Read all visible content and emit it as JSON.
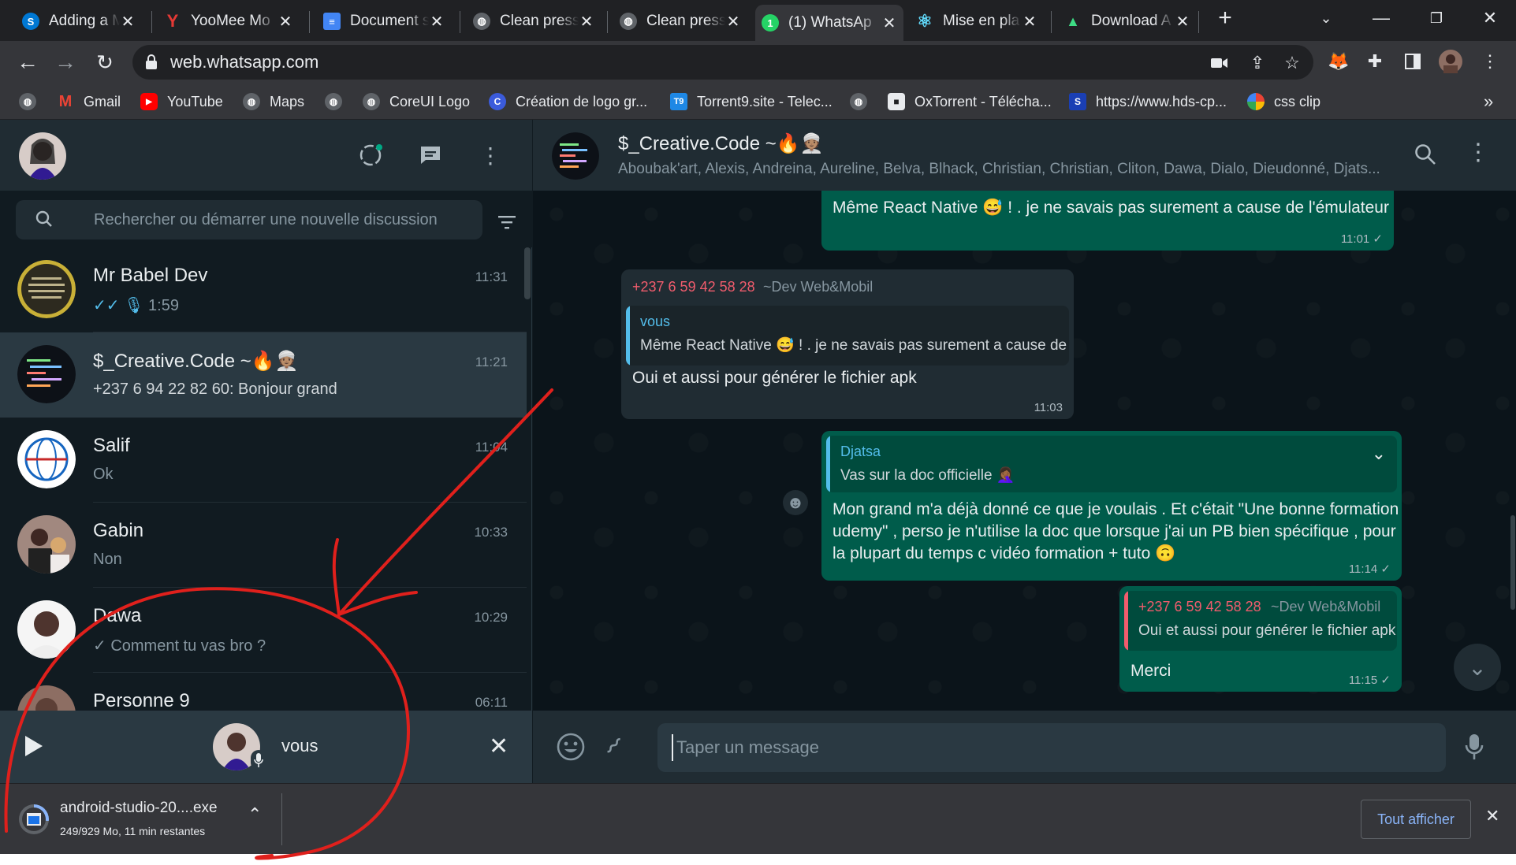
{
  "browser": {
    "tabs": [
      {
        "title": "Adding a M",
        "icon": "skype-icon",
        "color": "#0078d4",
        "glyph": "S"
      },
      {
        "title": "YooMee Mo",
        "icon": "yoomee-icon",
        "color": "#e53935",
        "glyph": "Y"
      },
      {
        "title": "Document s",
        "icon": "docs-icon",
        "color": "#4285f4",
        "glyph": "≡"
      },
      {
        "title": "Clean press",
        "icon": "globe-icon",
        "color": "#5f6368",
        "glyph": "◍"
      },
      {
        "title": "Clean press",
        "icon": "globe-icon",
        "color": "#5f6368",
        "glyph": "◍"
      },
      {
        "title": "(1) WhatsAp",
        "icon": "whatsapp-icon",
        "color": "#25d366",
        "glyph": "1"
      },
      {
        "title": "Mise en pla",
        "icon": "react-icon",
        "color": "#61dafb",
        "glyph": "⚛"
      },
      {
        "title": "Download A",
        "icon": "android-icon",
        "color": "#3ddc84",
        "glyph": "▲"
      }
    ],
    "url": "web.whatsapp.com",
    "bookmarks": [
      {
        "label": "",
        "icon": "globe-icon"
      },
      {
        "label": "Gmail",
        "icon": "gmail-icon"
      },
      {
        "label": "YouTube",
        "icon": "youtube-icon"
      },
      {
        "label": "Maps",
        "icon": "globe-icon"
      },
      {
        "label": "",
        "icon": "globe-icon"
      },
      {
        "label": "CoreUI Logo",
        "icon": "globe-icon"
      },
      {
        "label": "Création de logo gr...",
        "icon": "logo-maker-icon"
      },
      {
        "label": "Torrent9.site - Telec...",
        "icon": "torrent9-icon"
      },
      {
        "label": "",
        "icon": "globe-icon"
      },
      {
        "label": "OxTorrent - Télécha...",
        "icon": "oxtorrent-icon"
      },
      {
        "label": "https://www.hds-cp...",
        "icon": "hds-icon"
      },
      {
        "label": "css clip",
        "icon": "css-clip-icon"
      }
    ],
    "bookmarks_more": "»"
  },
  "sidebar": {
    "search_placeholder": "Rechercher ou démarrer une nouvelle discussion",
    "chats": [
      {
        "name": "Mr Babel Dev",
        "time": "11:31",
        "preview": "1:59",
        "preview_kind": "voice",
        "selected": false
      },
      {
        "name": "$_Creative.Code ~🔥👳🏽",
        "time": "11:21",
        "preview": "+237 6 94 22 82 60: Bonjour grand",
        "preview_kind": "text",
        "selected": true
      },
      {
        "name": "Salif",
        "time": "11:04",
        "preview": "Ok",
        "preview_kind": "text",
        "selected": false
      },
      {
        "name": "Gabin",
        "time": "10:33",
        "preview": "Non",
        "preview_kind": "text",
        "selected": false
      },
      {
        "name": "Dawa",
        "time": "10:29",
        "preview": "✓ Comment tu vas bro ?",
        "preview_kind": "text",
        "selected": false
      },
      {
        "name": "Personne 9",
        "time": "06:11",
        "preview": "",
        "preview_kind": "text",
        "selected": false
      }
    ],
    "player": {
      "label": "vous"
    }
  },
  "conversation": {
    "group_name": "$_Creative.Code ~🔥👳🏽",
    "members": "Aboubak'art, Alexis, Andreina, Aureline, Belva, Blhack, Christian, Christian, Cliton, Dawa, Dialo, Dieudonné, Djats...",
    "messages": [
      {
        "text": "Même React Native 😅 ! . je ne savais pas surement a cause de l'émulateur",
        "time": "11:01 ✓"
      },
      {
        "sender": "+237 6 59 42 58 28",
        "sender_alias": "~Dev Web&Mobil",
        "quote_author": "vous",
        "quote_text": "Même React Native 😅 ! . je ne savais pas surement a cause de l'émulateur",
        "text": "Oui et aussi pour générer le fichier apk",
        "time": "11:03"
      },
      {
        "quote_author": "Djatsa",
        "quote_text": "Vas sur la doc officielle 🤦🏾‍♀️",
        "text_lines": [
          "Mon grand m'a déjà donné ce que je voulais . Et c'était \"Une bonne formation",
          "udemy\" , perso je n'utilise la doc que lorsque j'ai un PB bien spécifique , pour",
          "la plupart du temps c vidéo formation + tuto 🙃"
        ],
        "time": "11:14 ✓"
      },
      {
        "quote_author": "+237 6 59 42 58 28",
        "quote_alias": "~Dev Web&Mobil",
        "quote_text": "Oui et aussi pour générer le fichier apk",
        "text": "Merci",
        "time": "11:15 ✓"
      }
    ],
    "compose_placeholder": "Taper un message"
  },
  "downloads": {
    "filename": "android-studio-20....exe",
    "progress_text": "249/929 Mo, 11 min restantes",
    "progress_fraction": 0.268,
    "show_all": "Tout afficher"
  },
  "colors": {
    "accent_green": "#00a884",
    "outgoing_bubble": "#005c4b",
    "incoming_bubble": "#202c33",
    "annotation_red": "#e0201c",
    "sender_red": "#f15c6d",
    "quote_blue": "#53bdeb"
  }
}
